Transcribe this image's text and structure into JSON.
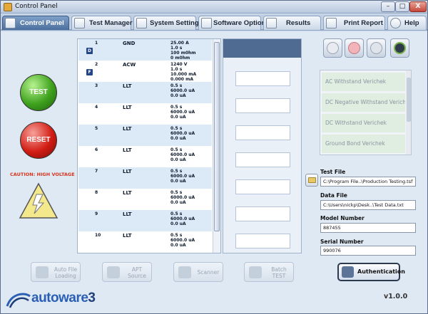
{
  "window": {
    "title": "Control Panel",
    "min": "–",
    "max": "□",
    "close": "X"
  },
  "tabs": [
    {
      "id": "control-panel",
      "label": "Control Panel",
      "active": true
    },
    {
      "id": "test-manager",
      "label": "Test Manager",
      "active": false
    },
    {
      "id": "system-settings",
      "label": "System Settings",
      "active": false
    },
    {
      "id": "software-options",
      "label": "Software Options",
      "active": false
    },
    {
      "id": "results",
      "label": "Results",
      "active": false
    },
    {
      "id": "print-report",
      "label": "Print Report",
      "active": false
    },
    {
      "id": "help",
      "label": "Help",
      "active": false
    }
  ],
  "controls": {
    "test_label": "TEST",
    "reset_label": "RESET",
    "caution": "CAUTION: HIGH VOLTAGE"
  },
  "steps": [
    {
      "num": "1",
      "type": "GND",
      "badge": "D",
      "params": [
        "25.00 A",
        "1.0 s",
        "100 m0hm",
        "0 m0hm"
      ],
      "shaded": true
    },
    {
      "num": "2",
      "type": "ACW",
      "badge": "F",
      "params": [
        "1240 V",
        "1.0 s",
        "10.000 mA",
        "0.000 mA"
      ],
      "shaded": false
    },
    {
      "num": "3",
      "type": "LLT",
      "badge": "",
      "params": [
        "0.5 s",
        "6000.0 uA",
        "0.0 uA"
      ],
      "shaded": true
    },
    {
      "num": "4",
      "type": "LLT",
      "badge": "",
      "params": [
        "0.5 s",
        "6000.0 uA",
        "0.0 uA"
      ],
      "shaded": false
    },
    {
      "num": "5",
      "type": "LLT",
      "badge": "",
      "params": [
        "0.5 s",
        "6000.0 uA",
        "0.0 uA"
      ],
      "shaded": true
    },
    {
      "num": "6",
      "type": "LLT",
      "badge": "",
      "params": [
        "0.5 s",
        "6000.0 uA",
        "0.0 uA"
      ],
      "shaded": false
    },
    {
      "num": "7",
      "type": "LLT",
      "badge": "",
      "params": [
        "0.5 s",
        "6000.0 uA",
        "0.0 uA"
      ],
      "shaded": true
    },
    {
      "num": "8",
      "type": "LLT",
      "badge": "",
      "params": [
        "0.5 s",
        "6000.0 uA",
        "0.0 uA"
      ],
      "shaded": false
    },
    {
      "num": "9",
      "type": "LLT",
      "badge": "",
      "params": [
        "0.5 s",
        "6000.0 uA",
        "0.0 uA"
      ],
      "shaded": true
    },
    {
      "num": "10",
      "type": "LLT",
      "badge": "",
      "params": [
        "0.5 s",
        "6000.0 uA",
        "0.0 uA"
      ],
      "shaded": false
    }
  ],
  "verify_items": [
    "AC Withstand Verichek",
    "DC Negative Withstand Verichek",
    "DC Withstand Verichek",
    "Ground Bond Verichek"
  ],
  "fields": {
    "test_file": {
      "label": "Test File",
      "value": "C:\\Program File..\\Production Testing.tsf"
    },
    "data_file": {
      "label": "Data File",
      "value": "C:\\Users\\nickp\\Desk..\\Test Data.txt"
    },
    "model_number": {
      "label": "Model Number",
      "value": "887455"
    },
    "serial_number": {
      "label": "Serial Number",
      "value": "990076"
    }
  },
  "actions": {
    "auto_file": [
      "Auto File",
      "Loading"
    ],
    "apt_source": [
      "APT",
      "Source"
    ],
    "scanner": [
      "Scanner"
    ],
    "batch_test": [
      "Batch",
      "TEST"
    ],
    "authentication": "Authentication"
  },
  "logo": {
    "text": "autoware",
    "suffix": "3"
  },
  "version": "v1.0.0",
  "colors": {
    "accent": "#4b6f9e",
    "test_green": "#3ea11d",
    "reset_red": "#d21d14",
    "caution": "#d9341b"
  }
}
